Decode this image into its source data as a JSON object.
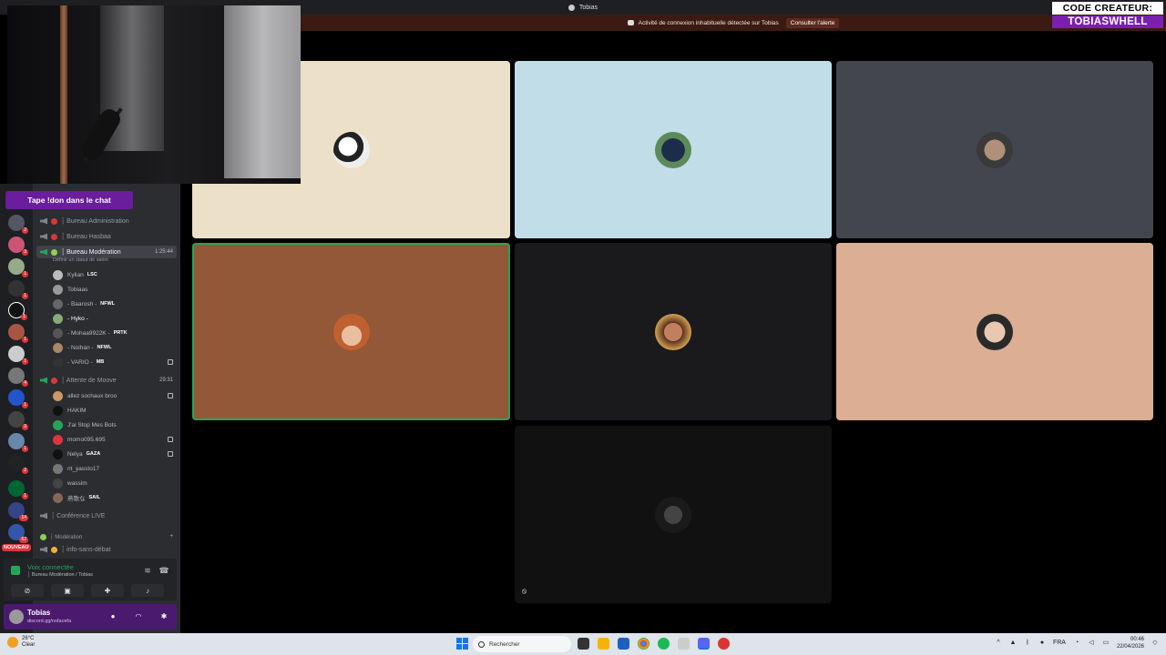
{
  "window": {
    "title": "Tobias"
  },
  "alert": {
    "text": "Activité de connexion inhabituelle détectée sur Tobias",
    "button": "Consulter l'alerte"
  },
  "overlay": {
    "creator_line1": "CODE CREATEUR:",
    "creator_line2": "TOBIASWHELL",
    "chat_prompt": "Tape !don dans le chat"
  },
  "servers": {
    "nouveau_label": "NOUVEAU",
    "badges": [
      "2",
      "3",
      "1",
      "1",
      "1",
      "1",
      "1",
      "4",
      "1",
      "3",
      "1",
      "2",
      "1",
      "1",
      "14",
      "62"
    ]
  },
  "channels": {
    "bureau_admin": "┆ Bureau Administration",
    "bureau_hasbaa": "┆ Bureau Hasbaa",
    "bureau_moderation": "┆ Bureau Modération",
    "bureau_moderation_time": "1:25:44",
    "bureau_moderation_status": "Définir un statut de salon",
    "moderation_users": [
      {
        "name": "Kylian",
        "tag": "LSC"
      },
      {
        "name": "Tobiaas",
        "tag": ""
      },
      {
        "name": "- Baarosh -",
        "tag": "NFWL"
      },
      {
        "name": "- Hyko -",
        "tag": ""
      },
      {
        "name": "- Mohaa9922K -",
        "tag": "PRTK"
      },
      {
        "name": "- Noihan -",
        "tag": "NFWL"
      },
      {
        "name": "- VARIO -",
        "tag": "MB"
      }
    ],
    "attente": "┆ Attente de Moove",
    "attente_time": "29:31",
    "attente_users": [
      {
        "name": "allez sochaux broo",
        "tag": ""
      },
      {
        "name": "HAKIM",
        "tag": ""
      },
      {
        "name": "J'ai Stop Mes Bots",
        "tag": ""
      },
      {
        "name": "momo095.695",
        "tag": ""
      },
      {
        "name": "Nelya",
        "tag": "GAZA"
      },
      {
        "name": "nt_yassto17",
        "tag": ""
      },
      {
        "name": "wassim",
        "tag": ""
      },
      {
        "name": "燕歌な",
        "tag": "SAIL"
      }
    ],
    "conference": "┆ Conférence LIVE",
    "category_moderation": "┆ Modération",
    "info_sans_debat": "┆ info-sans-débat"
  },
  "voice": {
    "connected": "Voix connectée",
    "location": "┆ Bureau Modération / Tobias"
  },
  "user": {
    "name": "Tobias",
    "status": "discord.gg/nofacefa"
  },
  "taskbar": {
    "weather_temp": "26°C",
    "weather_desc": "Clear",
    "search_placeholder": "Rechercher",
    "lang": "FRA",
    "time": "00:46",
    "date": "22/04/2026"
  },
  "colors": {
    "accent": "#23a55a",
    "brand": "#7b1fb0",
    "danger": "#da373c"
  }
}
